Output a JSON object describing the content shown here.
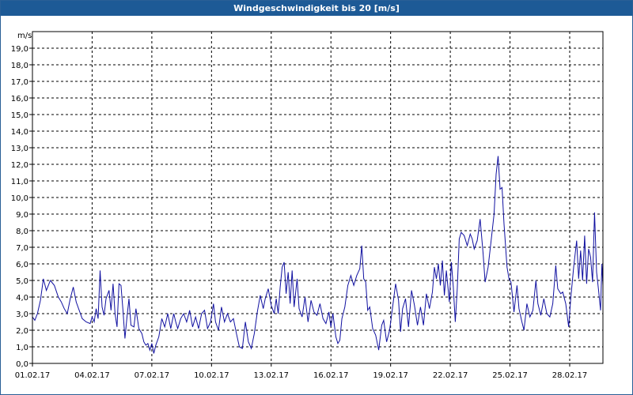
{
  "window": {
    "title": "Windgeschwindigkeit bis 20 [m/s]"
  },
  "colors": {
    "titlebar": "#1d5a96",
    "series": "#1010a0",
    "grid": "#000000"
  },
  "chart_data": {
    "type": "line",
    "title": "Windgeschwindigkeit bis 20 [m/s]",
    "ylabel": "m/s",
    "xlabel": "",
    "ylim": [
      0,
      20
    ],
    "xlim": [
      0,
      28.67
    ],
    "grid": true,
    "y_ticks": [
      "0,0",
      "1,0",
      "2,0",
      "3,0",
      "4,0",
      "5,0",
      "6,0",
      "7,0",
      "8,0",
      "9,0",
      "10,0",
      "11,0",
      "12,0",
      "13,0",
      "14,0",
      "15,0",
      "16,0",
      "17,0",
      "18,0",
      "19,0"
    ],
    "x_ticks": [
      {
        "day": 0,
        "label": "01.02.17"
      },
      {
        "day": 3,
        "label": "04.02.17"
      },
      {
        "day": 6,
        "label": "07.02.17"
      },
      {
        "day": 9,
        "label": "10.02.17"
      },
      {
        "day": 12,
        "label": "13.02.17"
      },
      {
        "day": 15,
        "label": "16.02.17"
      },
      {
        "day": 18,
        "label": "19.02.17"
      },
      {
        "day": 21,
        "label": "22.02.17"
      },
      {
        "day": 24,
        "label": "25.02.17"
      },
      {
        "day": 27,
        "label": "28.02.17"
      }
    ],
    "series": [
      {
        "color": "#1010a0",
        "points": [
          [
            0.0,
            2.8
          ],
          [
            0.12,
            2.6
          ],
          [
            0.25,
            3.0
          ],
          [
            0.4,
            3.8
          ],
          [
            0.55,
            5.1
          ],
          [
            0.7,
            4.4
          ],
          [
            0.9,
            5.0
          ],
          [
            1.1,
            4.7
          ],
          [
            1.3,
            4.0
          ],
          [
            1.45,
            3.7
          ],
          [
            1.6,
            3.3
          ],
          [
            1.75,
            3.0
          ],
          [
            1.9,
            3.9
          ],
          [
            2.05,
            4.6
          ],
          [
            2.2,
            3.7
          ],
          [
            2.35,
            3.2
          ],
          [
            2.5,
            2.7
          ],
          [
            2.7,
            2.5
          ],
          [
            2.9,
            2.4
          ],
          [
            3.0,
            2.8
          ],
          [
            3.1,
            2.5
          ],
          [
            3.2,
            3.3
          ],
          [
            3.3,
            2.7
          ],
          [
            3.4,
            5.6
          ],
          [
            3.5,
            3.4
          ],
          [
            3.6,
            2.9
          ],
          [
            3.7,
            3.9
          ],
          [
            3.85,
            4.4
          ],
          [
            3.95,
            3.2
          ],
          [
            4.05,
            4.8
          ],
          [
            4.15,
            3.0
          ],
          [
            4.25,
            2.2
          ],
          [
            4.35,
            4.8
          ],
          [
            4.45,
            4.7
          ],
          [
            4.55,
            3.2
          ],
          [
            4.65,
            1.5
          ],
          [
            4.75,
            2.8
          ],
          [
            4.85,
            3.9
          ],
          [
            4.95,
            2.3
          ],
          [
            5.1,
            2.2
          ],
          [
            5.2,
            3.3
          ],
          [
            5.35,
            2.1
          ],
          [
            5.5,
            1.8
          ],
          [
            5.6,
            1.3
          ],
          [
            5.7,
            1.1
          ],
          [
            5.8,
            1.2
          ],
          [
            5.9,
            0.8
          ],
          [
            6.0,
            1.2
          ],
          [
            6.1,
            0.6
          ],
          [
            6.2,
            1.1
          ],
          [
            6.35,
            1.6
          ],
          [
            6.5,
            2.7
          ],
          [
            6.65,
            2.2
          ],
          [
            6.8,
            3.0
          ],
          [
            6.95,
            2.1
          ],
          [
            7.1,
            3.0
          ],
          [
            7.2,
            2.5
          ],
          [
            7.3,
            2.1
          ],
          [
            7.45,
            2.7
          ],
          [
            7.6,
            3.0
          ],
          [
            7.75,
            2.5
          ],
          [
            7.9,
            3.2
          ],
          [
            8.05,
            2.2
          ],
          [
            8.2,
            2.8
          ],
          [
            8.35,
            2.1
          ],
          [
            8.5,
            3.0
          ],
          [
            8.65,
            3.2
          ],
          [
            8.8,
            2.1
          ],
          [
            8.95,
            2.5
          ],
          [
            9.1,
            3.6
          ],
          [
            9.2,
            2.5
          ],
          [
            9.35,
            2.0
          ],
          [
            9.5,
            3.4
          ],
          [
            9.65,
            2.5
          ],
          [
            9.8,
            3.0
          ],
          [
            9.95,
            2.5
          ],
          [
            10.1,
            2.7
          ],
          [
            10.25,
            1.8
          ],
          [
            10.4,
            1.0
          ],
          [
            10.55,
            0.9
          ],
          [
            10.7,
            2.5
          ],
          [
            10.85,
            1.3
          ],
          [
            11.0,
            0.9
          ],
          [
            11.15,
            1.8
          ],
          [
            11.3,
            3.1
          ],
          [
            11.45,
            4.1
          ],
          [
            11.6,
            3.3
          ],
          [
            11.7,
            3.9
          ],
          [
            11.85,
            4.5
          ],
          [
            12.0,
            3.5
          ],
          [
            12.15,
            3.0
          ],
          [
            12.25,
            3.9
          ],
          [
            12.35,
            3.0
          ],
          [
            12.45,
            4.6
          ],
          [
            12.55,
            5.8
          ],
          [
            12.65,
            6.1
          ],
          [
            12.75,
            4.2
          ],
          [
            12.85,
            5.5
          ],
          [
            12.95,
            3.6
          ],
          [
            13.05,
            5.6
          ],
          [
            13.15,
            3.4
          ],
          [
            13.3,
            5.1
          ],
          [
            13.4,
            3.3
          ],
          [
            13.55,
            2.8
          ],
          [
            13.7,
            4.0
          ],
          [
            13.85,
            2.5
          ],
          [
            14.0,
            3.8
          ],
          [
            14.15,
            3.1
          ],
          [
            14.3,
            2.9
          ],
          [
            14.45,
            3.6
          ],
          [
            14.6,
            2.7
          ],
          [
            14.75,
            2.4
          ],
          [
            14.9,
            3.1
          ],
          [
            15.0,
            2.2
          ],
          [
            15.1,
            3.0
          ],
          [
            15.25,
            1.6
          ],
          [
            15.35,
            1.2
          ],
          [
            15.45,
            1.4
          ],
          [
            15.55,
            2.7
          ],
          [
            15.7,
            3.4
          ],
          [
            15.85,
            4.7
          ],
          [
            16.0,
            5.3
          ],
          [
            16.15,
            4.7
          ],
          [
            16.3,
            5.3
          ],
          [
            16.45,
            5.7
          ],
          [
            16.55,
            7.1
          ],
          [
            16.65,
            5.1
          ],
          [
            16.75,
            4.9
          ],
          [
            16.85,
            3.2
          ],
          [
            16.95,
            3.4
          ],
          [
            17.1,
            2.1
          ],
          [
            17.25,
            1.7
          ],
          [
            17.4,
            0.8
          ],
          [
            17.55,
            2.3
          ],
          [
            17.65,
            2.6
          ],
          [
            17.8,
            1.3
          ],
          [
            17.95,
            2.0
          ],
          [
            18.1,
            3.4
          ],
          [
            18.25,
            4.8
          ],
          [
            18.4,
            3.8
          ],
          [
            18.5,
            1.9
          ],
          [
            18.6,
            3.3
          ],
          [
            18.75,
            3.9
          ],
          [
            18.9,
            2.2
          ],
          [
            19.05,
            4.4
          ],
          [
            19.2,
            3.5
          ],
          [
            19.35,
            2.3
          ],
          [
            19.5,
            3.4
          ],
          [
            19.65,
            2.3
          ],
          [
            19.8,
            4.2
          ],
          [
            19.95,
            3.3
          ],
          [
            20.1,
            4.3
          ],
          [
            20.2,
            5.8
          ],
          [
            20.3,
            5.1
          ],
          [
            20.4,
            6.0
          ],
          [
            20.5,
            4.7
          ],
          [
            20.6,
            6.2
          ],
          [
            20.7,
            4.1
          ],
          [
            20.8,
            5.6
          ],
          [
            20.95,
            3.7
          ],
          [
            21.05,
            6.1
          ],
          [
            21.15,
            4.6
          ],
          [
            21.25,
            2.5
          ],
          [
            21.35,
            4.5
          ],
          [
            21.45,
            7.5
          ],
          [
            21.55,
            7.9
          ],
          [
            21.7,
            7.7
          ],
          [
            21.85,
            7.1
          ],
          [
            22.0,
            7.8
          ],
          [
            22.1,
            7.5
          ],
          [
            22.2,
            6.9
          ],
          [
            22.35,
            7.4
          ],
          [
            22.5,
            8.7
          ],
          [
            22.65,
            6.6
          ],
          [
            22.75,
            4.9
          ],
          [
            22.9,
            5.8
          ],
          [
            23.05,
            7.4
          ],
          [
            23.2,
            9.0
          ],
          [
            23.3,
            11.4
          ],
          [
            23.4,
            12.5
          ],
          [
            23.5,
            10.5
          ],
          [
            23.6,
            10.6
          ],
          [
            23.7,
            8.4
          ],
          [
            23.85,
            5.8
          ],
          [
            23.95,
            5.1
          ],
          [
            24.05,
            4.9
          ],
          [
            24.2,
            3.1
          ],
          [
            24.35,
            4.7
          ],
          [
            24.45,
            3.3
          ],
          [
            24.6,
            2.5
          ],
          [
            24.7,
            2.0
          ],
          [
            24.85,
            3.6
          ],
          [
            25.0,
            2.8
          ],
          [
            25.15,
            3.2
          ],
          [
            25.3,
            5.0
          ],
          [
            25.4,
            3.6
          ],
          [
            25.55,
            2.9
          ],
          [
            25.7,
            3.9
          ],
          [
            25.85,
            3.0
          ],
          [
            26.0,
            2.8
          ],
          [
            26.15,
            3.6
          ],
          [
            26.3,
            5.9
          ],
          [
            26.4,
            4.5
          ],
          [
            26.55,
            4.2
          ],
          [
            26.65,
            4.3
          ],
          [
            26.8,
            3.6
          ],
          [
            26.95,
            2.2
          ],
          [
            27.05,
            3.9
          ],
          [
            27.2,
            5.8
          ],
          [
            27.35,
            7.4
          ],
          [
            27.45,
            5.1
          ],
          [
            27.55,
            6.8
          ],
          [
            27.65,
            5.0
          ],
          [
            27.75,
            7.7
          ],
          [
            27.85,
            4.8
          ],
          [
            27.95,
            6.9
          ],
          [
            28.05,
            6.4
          ],
          [
            28.15,
            4.9
          ],
          [
            28.25,
            9.1
          ],
          [
            28.35,
            5.5
          ],
          [
            28.45,
            4.4
          ],
          [
            28.55,
            3.2
          ],
          [
            28.62,
            6.0
          ],
          [
            28.67,
            4.7
          ]
        ]
      }
    ]
  }
}
